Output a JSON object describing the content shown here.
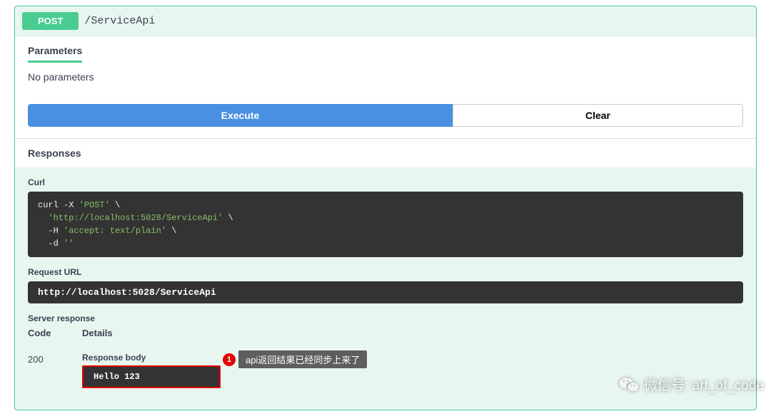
{
  "op": {
    "method": "POST",
    "path": "/ServiceApi"
  },
  "sections": {
    "parameters_label": "Parameters",
    "no_params": "No parameters",
    "execute": "Execute",
    "clear": "Clear",
    "responses_label": "Responses",
    "curl_label": "Curl",
    "request_url_label": "Request URL",
    "server_response_label": "Server response",
    "code_header": "Code",
    "details_header": "Details",
    "response_body_label": "Response body"
  },
  "curl": {
    "l1a": "curl -X ",
    "l1b": "'POST'",
    "l1c": " \\",
    "l2a": "  ",
    "l2b": "'http://localhost:5028/ServiceApi'",
    "l2c": " \\",
    "l3a": "  -H ",
    "l3b": "'accept: text/plain'",
    "l3c": " \\",
    "l4a": "  -d ",
    "l4b": "''"
  },
  "request_url": "http://localhost:5028/ServiceApi",
  "response": {
    "code": "200",
    "body": "Hello 123"
  },
  "annotation": {
    "num": "1",
    "text": "api返回结果已经同步上来了"
  },
  "watermark": {
    "text": "微信号: art_of_code"
  }
}
